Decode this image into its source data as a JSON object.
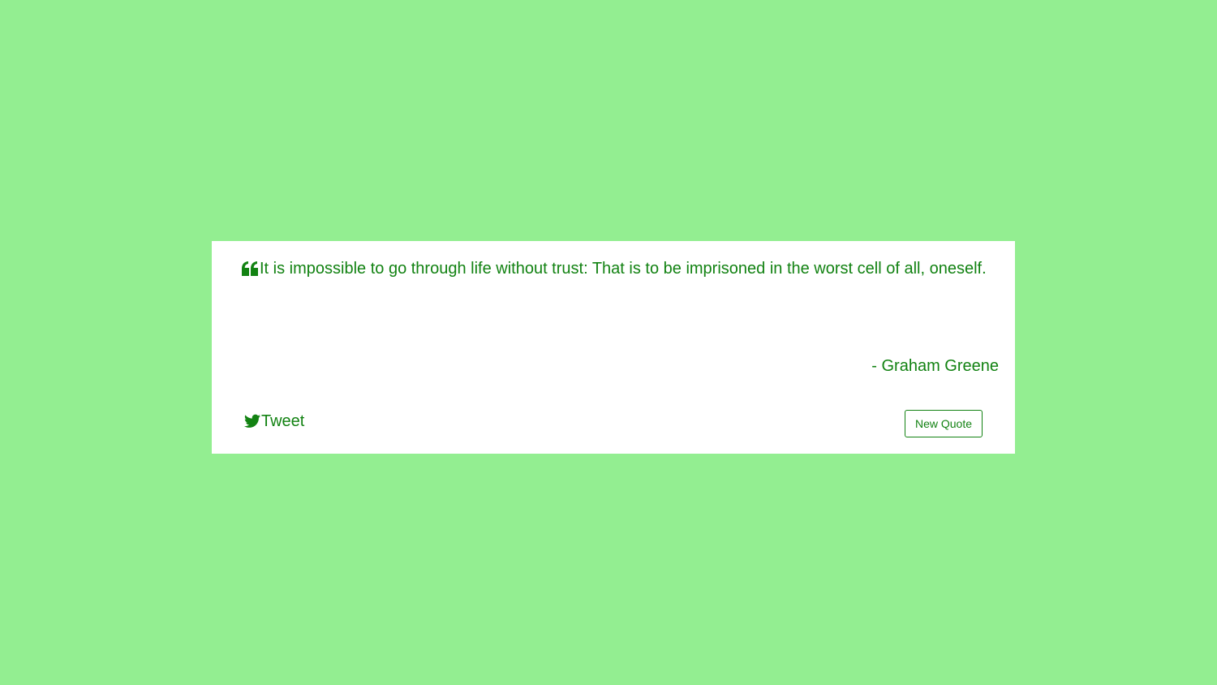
{
  "colors": {
    "page_background": "#93ee91",
    "card_background": "#ffffff",
    "accent": "#128212"
  },
  "quote": {
    "icon": "quote-left-icon",
    "text": "It is impossible to go through life without trust: That is to be imprisoned in the worst cell of all, oneself.",
    "author": "- Graham Greene"
  },
  "actions": {
    "tweet_icon": "twitter-icon",
    "tweet_label": "Tweet",
    "new_quote_label": "New Quote"
  }
}
